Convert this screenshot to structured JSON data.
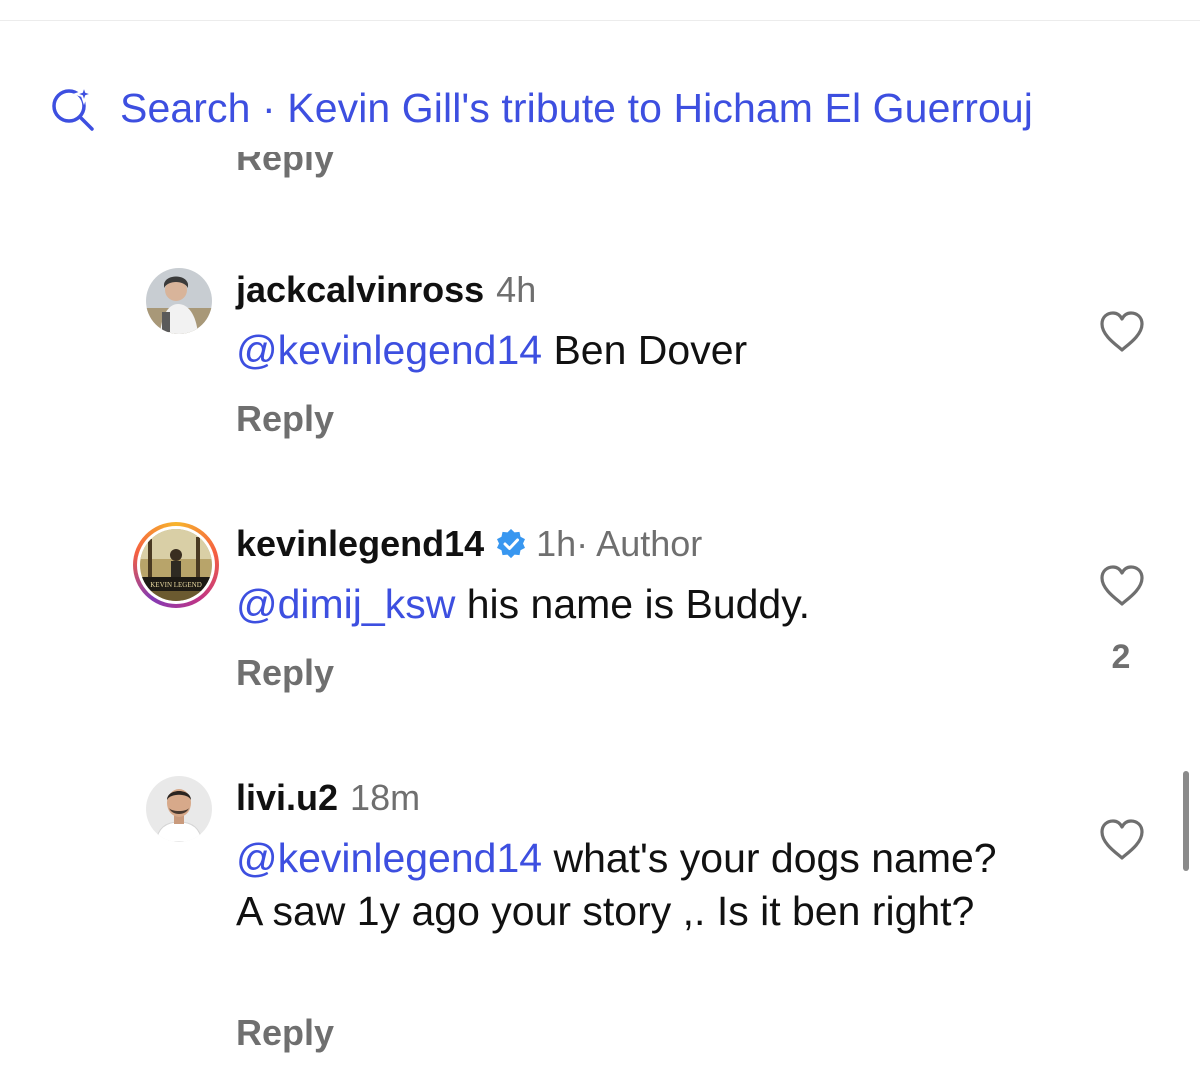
{
  "search": {
    "icon": "search-sparkle-icon",
    "text": "Search · Kevin Gill's tribute to Hicham El Guerrouj",
    "color": "#3d4fe0"
  },
  "partial_reply_label": "Reply",
  "comments": [
    {
      "username": "jackcalvinross",
      "time": "4h",
      "author_tag": "",
      "verified": false,
      "mention": "@kevinlegend14",
      "text": " Ben Dover",
      "reply_label": "Reply",
      "like_icon": "heart-outline-icon",
      "like_count": ""
    },
    {
      "username": "kevinlegend14",
      "time": "1h",
      "author_tag": " · Author",
      "verified": true,
      "mention": "@dimij_ksw",
      "text": " his name is Buddy.",
      "reply_label": "Reply",
      "like_icon": "heart-outline-icon",
      "like_count": "2"
    },
    {
      "username": "livi.u2",
      "time": "18m",
      "author_tag": "",
      "verified": false,
      "mention": "@kevinlegend14",
      "text": " what's your dogs name? A saw 1y ago your story ,. Is it ben right?",
      "reply_label": "Reply",
      "like_icon": "heart-outline-icon",
      "like_count": ""
    }
  ],
  "colors": {
    "link": "#3d4fe0",
    "secondary_text": "#6f6f6f",
    "verified_badge": "#3897f0",
    "story_ring": [
      "#f7b52c",
      "#f56040",
      "#c13584",
      "#833ab4"
    ]
  }
}
